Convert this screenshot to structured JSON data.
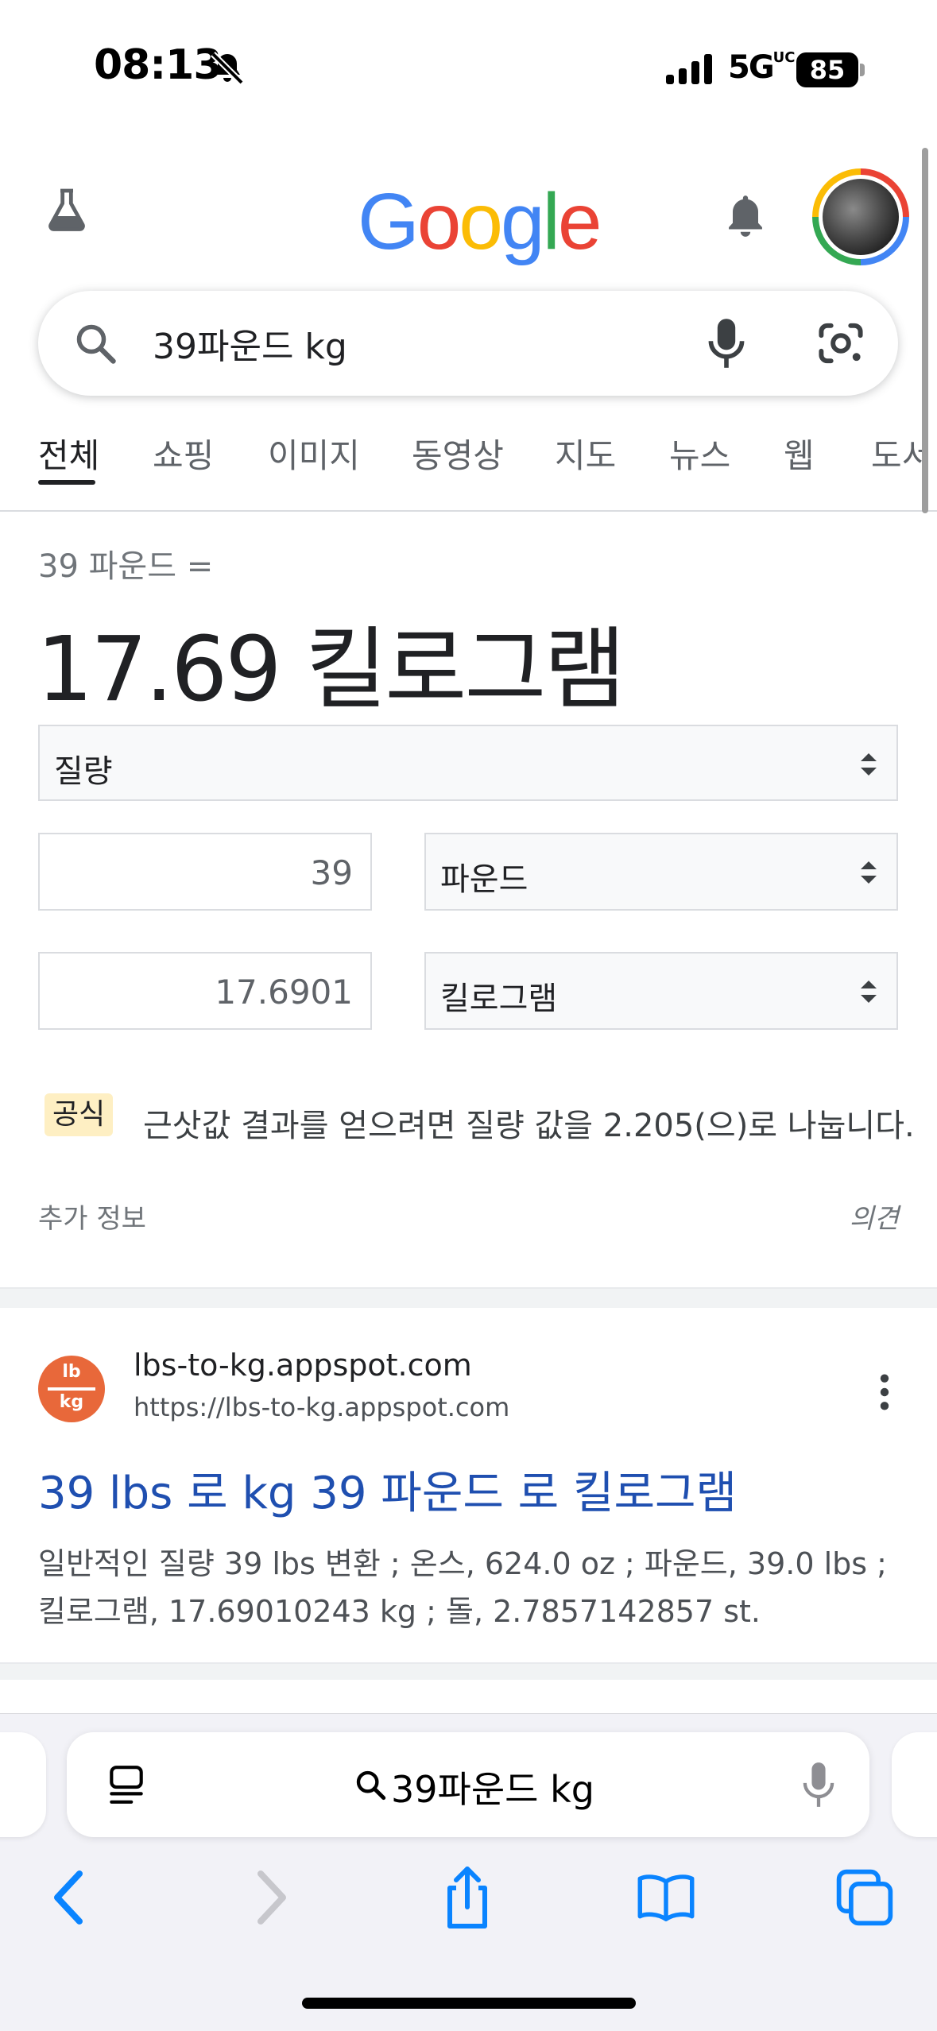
{
  "status_bar": {
    "time": "08:13",
    "network": "5G",
    "network_sup": "UC",
    "battery": "85"
  },
  "header": {
    "logo": [
      "G",
      "o",
      "o",
      "g",
      "l",
      "e"
    ],
    "logo_colors": [
      "#4285f4",
      "#ea4335",
      "#fbbc05",
      "#4285f4",
      "#34a853",
      "#ea4335"
    ]
  },
  "search": {
    "query": "39파운드 kg"
  },
  "tabs": [
    "전체",
    "쇼핑",
    "이미지",
    "동영상",
    "지도",
    "뉴스",
    "웹",
    "도서"
  ],
  "converter": {
    "equation": "39 파운드 =",
    "result": "17.69 킬로그램",
    "quantity": "질량",
    "from_value": "39",
    "from_unit": "파운드",
    "to_value": "17.6901",
    "to_unit": "킬로그램",
    "formula_badge": "공식",
    "formula": "근삿값 결과를 얻으려면 질량 값을 2.205(으)로 나눕니다.",
    "more_info": "추가 정보",
    "feedback": "의견"
  },
  "result": {
    "favicon_top": "lb",
    "favicon_bottom": "kg",
    "site_name": "lbs-to-kg.appspot.com",
    "url": "https://lbs-to-kg.appspot.com",
    "title": "39 lbs 로 kg 39 파운드 로 킬로그램",
    "snippet": "일반적인 질량 39 lbs 변환 ; 온스, 624.0 oz ; 파운드, 39.0 lbs ; 킬로그램, 17.69010243 kg ; 돌, 2.7857142857 st."
  },
  "safari": {
    "address": "39파운드 kg",
    "accent": "#0a84ff"
  }
}
